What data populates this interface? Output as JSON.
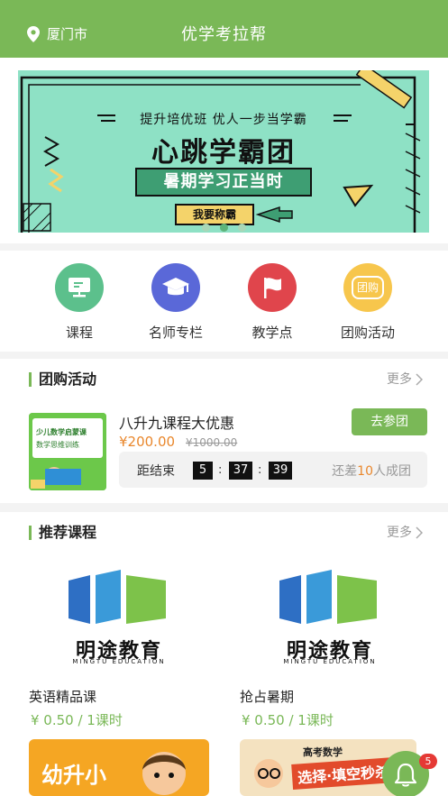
{
  "header": {
    "city": "厦门市",
    "title": "优学考拉帮"
  },
  "banner": {
    "line1": "提升培优班  优人一步当学霸",
    "line2": "心跳学霸团",
    "line3": "暑期学习正当时",
    "button": "我要称霸"
  },
  "categories": [
    {
      "label": "课程",
      "color": "#5cc08c"
    },
    {
      "label": "名师专栏",
      "color": "#5a68d8"
    },
    {
      "label": "教学点",
      "color": "#e0454c"
    },
    {
      "label": "团购活动",
      "color": "#f7c64c",
      "icon_text": "团购"
    }
  ],
  "group_buy": {
    "title": "团购活动",
    "more": "更多",
    "item": {
      "thumb_text": [
        "少儿数学启蒙课",
        "数学思维训练"
      ],
      "name": "八升九课程大优惠",
      "price": "¥200.00",
      "old_price": "¥1000.00",
      "join": "去参团",
      "countdown_label": "距结束",
      "hours": "5",
      "minutes": "37",
      "seconds": "39",
      "need_prefix": "还差",
      "need_count": "10",
      "need_suffix": "人成团"
    }
  },
  "recommend": {
    "title": "推荐课程",
    "more": "更多",
    "courses": [
      {
        "logo_cn": "明途教育",
        "logo_en": "MINGTU EDUCATION",
        "name": "英语精品课",
        "price": "¥ 0.50 / 1课时"
      },
      {
        "logo_cn": "明途教育",
        "logo_en": "MINGTU EDUCATION",
        "name": "抢占暑期",
        "price": "¥ 0.50 / 1课时"
      }
    ],
    "thumbs": [
      {
        "text": "幼升小"
      },
      {
        "text_top": "高考数学",
        "text_bottom": "选择·填空秒杀"
      }
    ]
  },
  "notification": {
    "count": "5"
  },
  "colors": {
    "brand": "#7ab857",
    "accent": "#e9872c"
  }
}
